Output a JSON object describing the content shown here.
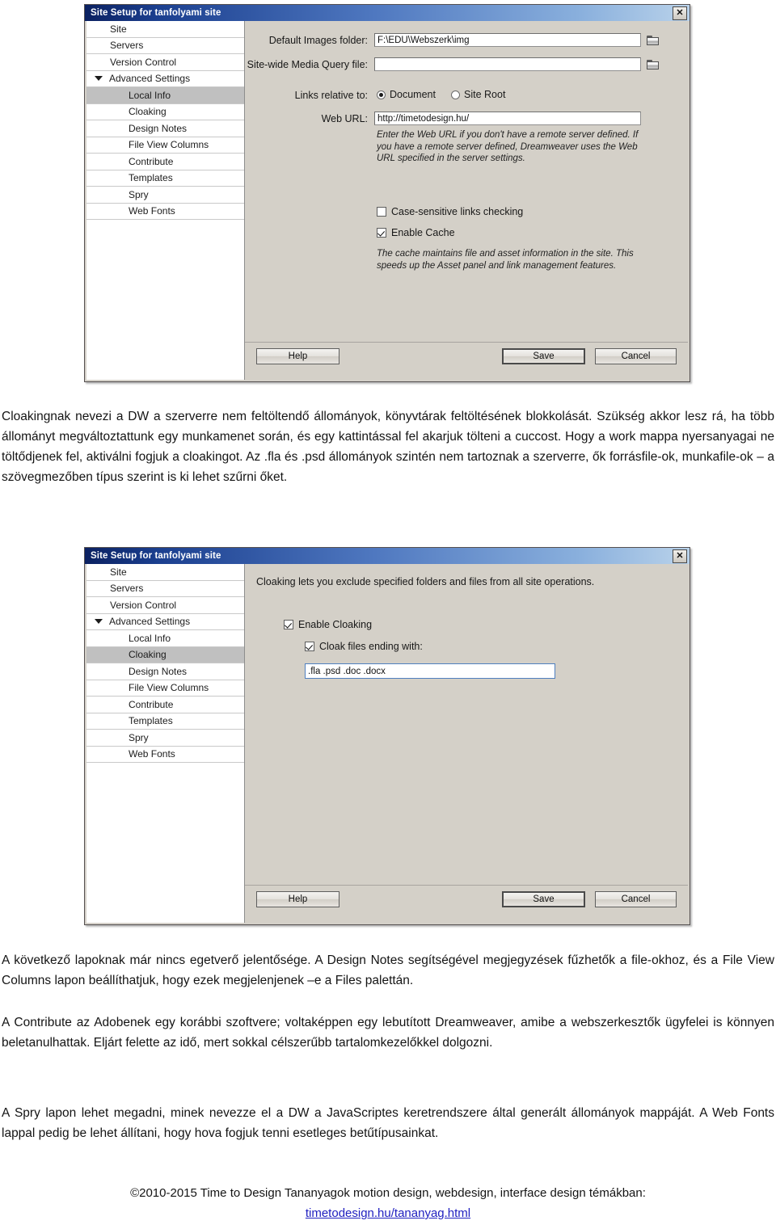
{
  "dialog1": {
    "title": "Site Setup for tanfolyami site",
    "close_label": "✕",
    "sidebar": [
      {
        "label": "Site",
        "level": 0,
        "selected": false,
        "group": false
      },
      {
        "label": "Servers",
        "level": 0,
        "selected": false,
        "group": false
      },
      {
        "label": "Version Control",
        "level": 0,
        "selected": false,
        "group": false
      },
      {
        "label": "Advanced Settings",
        "level": 0,
        "selected": false,
        "group": true
      },
      {
        "label": "Local Info",
        "level": 1,
        "selected": true,
        "group": false
      },
      {
        "label": "Cloaking",
        "level": 1,
        "selected": false,
        "group": false
      },
      {
        "label": "Design Notes",
        "level": 1,
        "selected": false,
        "group": false
      },
      {
        "label": "File View Columns",
        "level": 1,
        "selected": false,
        "group": false
      },
      {
        "label": "Contribute",
        "level": 1,
        "selected": false,
        "group": false
      },
      {
        "label": "Templates",
        "level": 1,
        "selected": false,
        "group": false
      },
      {
        "label": "Spry",
        "level": 1,
        "selected": false,
        "group": false
      },
      {
        "label": "Web Fonts",
        "level": 1,
        "selected": false,
        "group": false
      }
    ],
    "default_images_label": "Default Images folder:",
    "default_images_value": "F:\\EDU\\Webszerk\\img",
    "media_query_label": "Site-wide Media Query file:",
    "media_query_value": "",
    "links_relative_label": "Links relative to:",
    "radio_document": "Document",
    "radio_site_root": "Site Root",
    "web_url_label": "Web URL:",
    "web_url_value": "http://timetodesign.hu/",
    "web_url_help": "Enter the Web URL if you don't have a remote server defined. If you have a remote server defined, Dreamweaver uses the Web URL specified in the server settings.",
    "case_sensitive_label": "Case-sensitive links checking",
    "enable_cache_label": "Enable Cache",
    "cache_help": "The cache maintains file and asset information in the site. This speeds up the Asset panel and link management features.",
    "help_button": "Help",
    "save_button": "Save",
    "cancel_button": "Cancel"
  },
  "dialog2": {
    "title": "Site Setup for tanfolyami site",
    "close_label": "✕",
    "sidebar": [
      {
        "label": "Site",
        "level": 0,
        "selected": false,
        "group": false
      },
      {
        "label": "Servers",
        "level": 0,
        "selected": false,
        "group": false
      },
      {
        "label": "Version Control",
        "level": 0,
        "selected": false,
        "group": false
      },
      {
        "label": "Advanced Settings",
        "level": 0,
        "selected": false,
        "group": true
      },
      {
        "label": "Local Info",
        "level": 1,
        "selected": false,
        "group": false
      },
      {
        "label": "Cloaking",
        "level": 1,
        "selected": true,
        "group": false
      },
      {
        "label": "Design Notes",
        "level": 1,
        "selected": false,
        "group": false
      },
      {
        "label": "File View Columns",
        "level": 1,
        "selected": false,
        "group": false
      },
      {
        "label": "Contribute",
        "level": 1,
        "selected": false,
        "group": false
      },
      {
        "label": "Templates",
        "level": 1,
        "selected": false,
        "group": false
      },
      {
        "label": "Spry",
        "level": 1,
        "selected": false,
        "group": false
      },
      {
        "label": "Web Fonts",
        "level": 1,
        "selected": false,
        "group": false
      }
    ],
    "description": "Cloaking lets you exclude specified folders and files from all site operations.",
    "enable_cloaking_label": "Enable Cloaking",
    "cloak_files_label": "Cloak files ending with:",
    "cloak_extensions_value": ".fla .psd .doc .docx",
    "help_button": "Help",
    "save_button": "Save",
    "cancel_button": "Cancel"
  },
  "body": {
    "para1": "Cloakingnak nevezi a DW a szerverre nem feltöltendő állományok, könyvtárak feltöltésének blokkolását. Szükség akkor lesz rá, ha több állományt megváltoztattunk egy munkamenet során, és egy kattintással fel akarjuk tölteni a cuccost. Hogy a work mappa nyersanyagai ne töltődjenek fel, aktiválni fogjuk a cloakingot. Az .fla és .psd állományok szintén nem tartoznak a szerverre, ők forrásfile-ok, munkafile-ok – a szövegmezőben típus szerint is ki lehet szűrni őket.",
    "para2": "A következő lapoknak már nincs egetverő jelentősége. A Design Notes segítségével megjegyzések fűzhetők a file-okhoz, és a File View Columns lapon beállíthatjuk, hogy ezek megjelenjenek –e a Files palettán.",
    "para3": "A Contribute az Adobenek egy korábbi szoftvere; voltaképpen egy lebutított Dreamweaver, amibe a webszerkesztők ügyfelei is könnyen beletanulhattak. Eljárt felette az idő, mert sokkal célszerűbb tartalomkezelőkkel dolgozni.",
    "para4": "A Spry lapon lehet megadni, minek nevezze el a DW a JavaScriptes keretrendszere által generált állományok mappáját. A Web Fonts lappal pedig be lehet állítani, hogy hova fogjuk tenni esetleges betűtípusainkat.",
    "footer_text": "©2010-2015 Time to Design Tananyagok motion design, webdesign, interface design témákban:",
    "footer_link": "timetodesign.hu/tananyag.html"
  },
  "colors": {
    "title_start": "#0b2161",
    "title_end": "#b9d2ea",
    "dialog_bg": "#d4d0c8",
    "selected_row": "#c0c0c0",
    "link": "#2020c0"
  }
}
